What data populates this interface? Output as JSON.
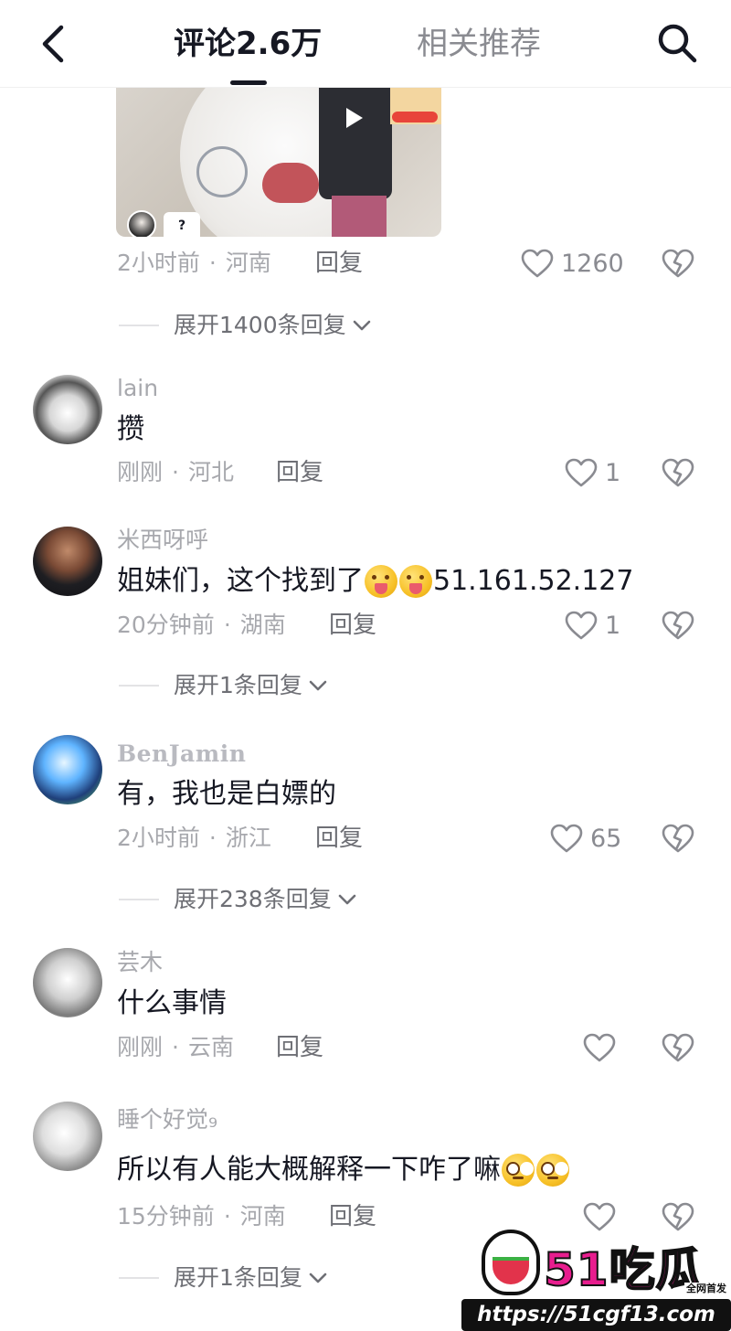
{
  "header": {
    "comments_tab": "评论2.6万",
    "related_tab": "相关推荐"
  },
  "video_thumbnail": {
    "badge_text": "?"
  },
  "top_comment": {
    "meta": {
      "time": "2小时前",
      "location": "河南"
    },
    "reply_label": "回复",
    "likes": "1260",
    "expand_label": "展开1400条回复"
  },
  "comments": [
    {
      "username": "lain",
      "content": "攒",
      "time": "刚刚",
      "location": "河北",
      "reply_label": "回复",
      "likes": "1"
    },
    {
      "username": "米西呀呼",
      "content_prefix": "姐妹们，这个找到了",
      "emojis": [
        "tongue-out-emoji",
        "tongue-out-emoji"
      ],
      "content_suffix": "51.161.52.127",
      "time": "20分钟前",
      "location": "湖南",
      "reply_label": "回复",
      "likes": "1",
      "expand_label": "展开1条回复"
    },
    {
      "username": "BenJamin",
      "content": "有，我也是白嫖的",
      "time": "2小时前",
      "location": "浙江",
      "reply_label": "回复",
      "likes": "65",
      "expand_label": "展开238条回复"
    },
    {
      "username": "芸木",
      "content": "什么事情",
      "time": "刚刚",
      "location": "云南",
      "reply_label": "回复",
      "likes": ""
    },
    {
      "username": "睡个好觉",
      "username_suffix": "₉",
      "content": "所以有人能大概解释一下咋了嘛",
      "emojis": [
        "flushed-emoji",
        "flushed-emoji"
      ],
      "time": "15分钟前",
      "location": "河南",
      "reply_label": "回复",
      "likes": "",
      "expand_label": "展开1条回复"
    }
  ],
  "watermark": {
    "title": "51吃瓜",
    "tag": "全网首发",
    "url": "https://51cgf13.com"
  },
  "icons": {
    "back": "chevron-left-icon",
    "search": "search-icon",
    "like": "heart-outline-icon",
    "dislike": "broken-heart-icon",
    "expand": "chevron-down-icon"
  },
  "colors": {
    "primary_text": "#161823",
    "secondary_text": "#a7a8ad",
    "action_text": "#6e6f75",
    "watermark_pink": "#e81d8e"
  }
}
